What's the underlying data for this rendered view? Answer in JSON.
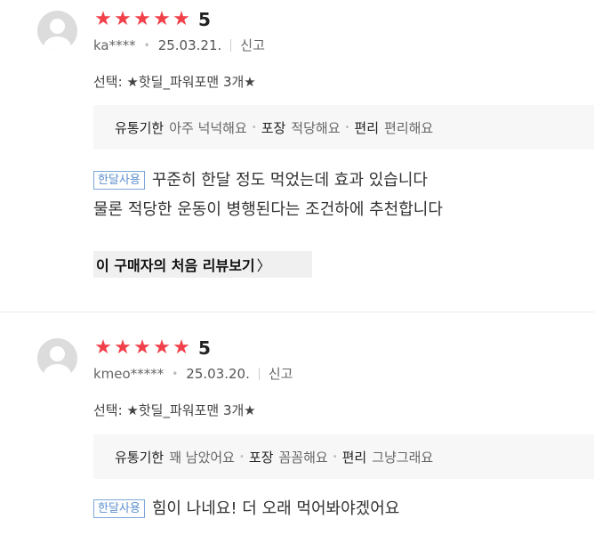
{
  "reviews": [
    {
      "score": "5",
      "user": "ka****",
      "date": "25.03.21.",
      "report_label": "신고",
      "option": "선택: ★핫딜_파워포맨 3개★",
      "evaluations": [
        {
          "key": "유통기한",
          "value": "아주 넉넉해요"
        },
        {
          "key": "포장",
          "value": "적당해요"
        },
        {
          "key": "편리",
          "value": "편리해요"
        }
      ],
      "tag": "한달사용",
      "content_line1": "꾸준히 한달 정도 먹었는데 효과 있습니다",
      "content_line2": "물론 적당한 운동이 병행된다는 조건하에 추천합니다",
      "first_review_label": "이 구매자의 처음 리뷰보기",
      "first_review_chevron": "〉"
    },
    {
      "score": "5",
      "user": "kmeo*****",
      "date": "25.03.20.",
      "report_label": "신고",
      "option": "선택: ★핫딜_파워포맨 3개★",
      "evaluations": [
        {
          "key": "유통기한",
          "value": "꽤 남았어요"
        },
        {
          "key": "포장",
          "value": "꼼꼼해요"
        },
        {
          "key": "편리",
          "value": "그냥그래요"
        }
      ],
      "tag": "한달사용",
      "content_line1": "힘이 나네요! 더 오래 먹어봐야겠어요"
    }
  ],
  "star_glyph": "★",
  "star_color": "#f2404a",
  "tag_color": "#5c8fcf",
  "icons": {
    "avatar": "default-user-avatar",
    "star": "star-icon"
  }
}
